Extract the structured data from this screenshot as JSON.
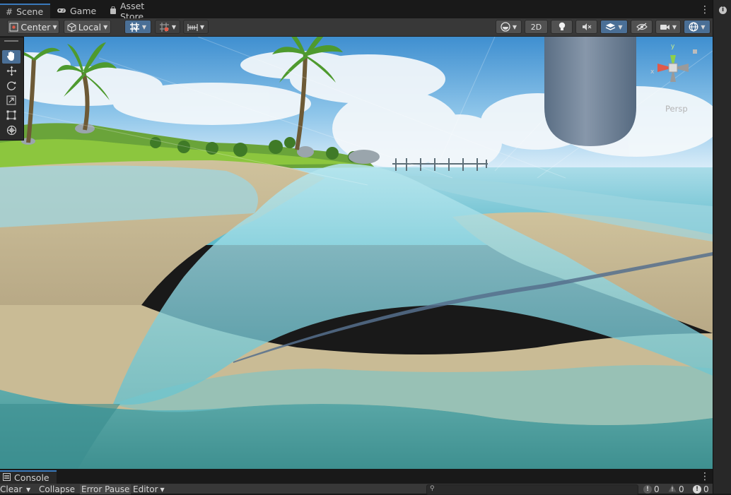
{
  "tabs": [
    {
      "label": "Scene",
      "icon": "grid-icon"
    },
    {
      "label": "Game",
      "icon": "gamepad-icon"
    },
    {
      "label": "Asset Store",
      "icon": "shopping-bag-icon"
    }
  ],
  "toolbar": {
    "pivot_label": "Center",
    "space_label": "Local",
    "mode_2d_label": "2D"
  },
  "gizmo": {
    "projection_label": "Persp",
    "axis_x": "x",
    "axis_y": "y"
  },
  "console": {
    "tab_label": "Console",
    "clear_label": "Clear",
    "collapse_label": "Collapse",
    "error_pause_label": "Error Pause",
    "editor_label": "Editor",
    "search_placeholder": "",
    "info_count": "0",
    "warning_count": "0",
    "error_count": "0"
  },
  "colors": {
    "accent": "#4a6f96",
    "active_tab_border": "#3a79bb",
    "toolbar_bg": "#383838",
    "panel_bg": "#191919"
  }
}
